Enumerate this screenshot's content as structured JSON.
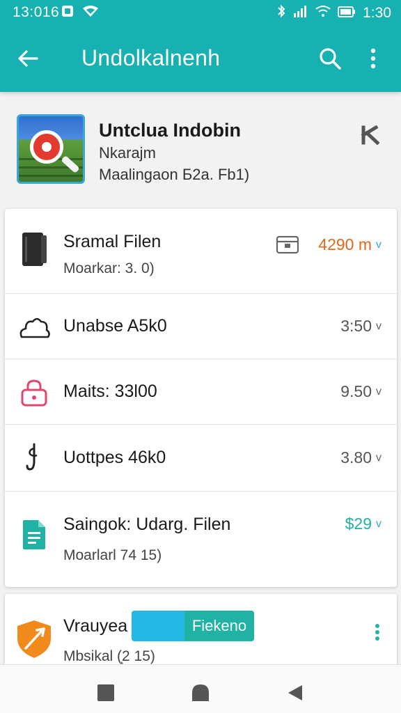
{
  "status_bar": {
    "time": "13:016",
    "right_time": "1:30",
    "icons": [
      "notification-icon",
      "wifi-icon",
      "bluetooth-icon",
      "signal-icon",
      "wifi-icon",
      "battery-icon"
    ]
  },
  "app_bar": {
    "title": "Undolkalnenh",
    "back_icon": "arrow-back-icon",
    "search_icon": "search-icon",
    "more_icon": "more-vert-icon"
  },
  "header": {
    "title": "Untclua Indobin",
    "subtitle": "Nkarajm",
    "detail": "Maalingaon Б2a. Fb1)",
    "close_icon": "close-icon"
  },
  "list": [
    {
      "icon": "device-icon",
      "title": "Sramal Filen",
      "subtitle": "Moarkar: 3. 0)",
      "value": "4290 m",
      "value_color": "#e0681a",
      "chevron_color": "#3aa6d6",
      "badge_icon": "calendar-icon"
    },
    {
      "icon": "cloud-icon",
      "title": "Unabse A5k0",
      "value": "3:50",
      "value_color": "#555555"
    },
    {
      "icon": "lock-icon",
      "title": "Maits: 33l00",
      "value": "9.50",
      "value_color": "#555555"
    },
    {
      "icon": "hook-icon",
      "title": "Uottpes 46k0",
      "value": "3.80",
      "value_color": "#555555"
    },
    {
      "icon": "document-icon",
      "title": "Saingok: Udarg. Filen",
      "subtitle": "Moarlarl 74 15)",
      "value": "$29",
      "value_color": "#1fb2a5",
      "chevron_color": "#3aa6d6"
    }
  ],
  "bottom_item": {
    "icon": "shield-icon",
    "title": "Vrauyea",
    "toggle_label": "Fiekeno",
    "subtitle": "Mbsikal (ͅ2 15)",
    "more_icon": "more-vert-icon"
  },
  "nav_bar": {
    "icons": [
      "recents-icon",
      "home-icon",
      "back-icon"
    ]
  },
  "colors": {
    "primary": "#16b1b0",
    "accent": "#1fb2a5",
    "orange": "#e0681a",
    "toggle_blue": "#23b7e5"
  }
}
